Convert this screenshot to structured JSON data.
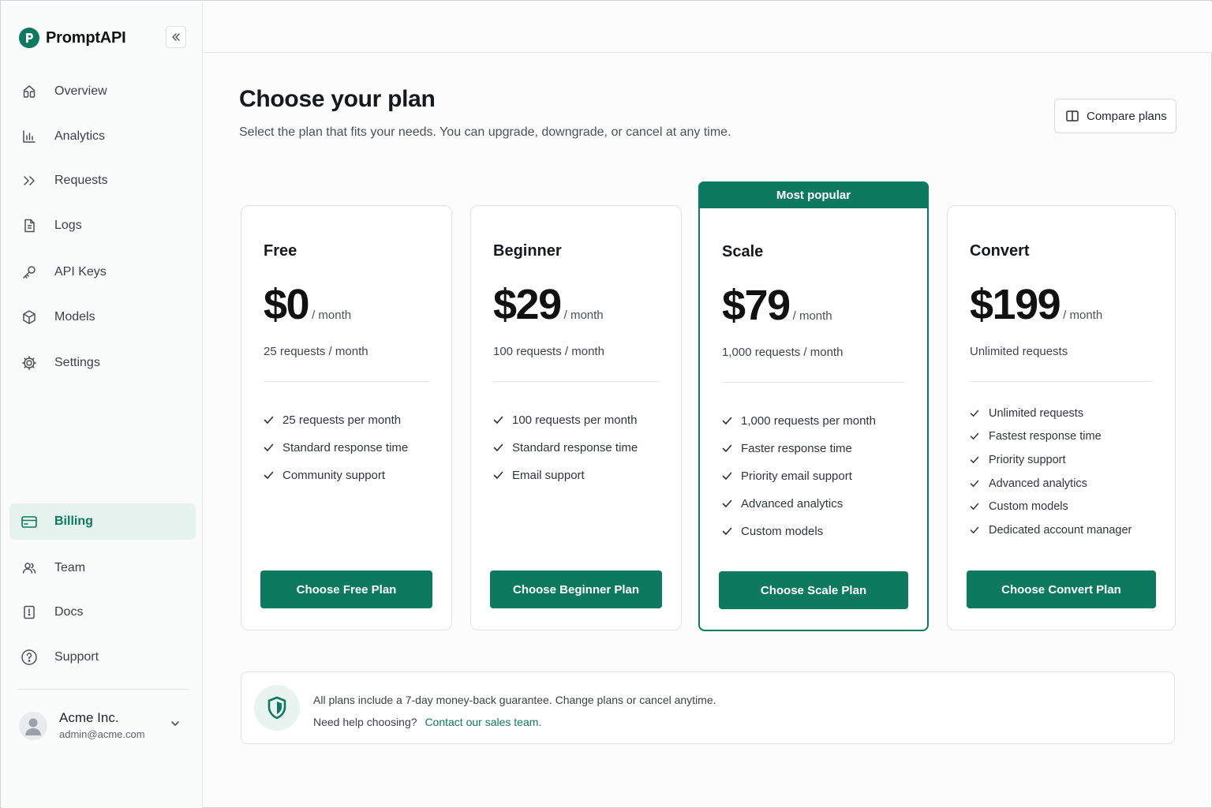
{
  "brand": {
    "name": "PromptAPI"
  },
  "sidebar": {
    "items": [
      {
        "label": "Overview",
        "icon": "home-icon"
      },
      {
        "label": "Analytics",
        "icon": "bar-chart-icon"
      },
      {
        "label": "Requests",
        "icon": "chevrons-right-icon"
      },
      {
        "label": "Logs",
        "icon": "document-icon"
      },
      {
        "label": "API Keys",
        "icon": "key-icon"
      },
      {
        "label": "Models",
        "icon": "cube-icon"
      },
      {
        "label": "Settings",
        "icon": "gear-icon"
      },
      {
        "label": "Billing",
        "icon": "credit-card-icon",
        "active": true
      },
      {
        "label": "Team",
        "icon": "users-icon"
      },
      {
        "label": "Docs",
        "icon": "book-icon"
      },
      {
        "label": "Support",
        "icon": "help-circle-icon"
      }
    ],
    "account": {
      "name": "Acme Inc.",
      "email": "admin@acme.com"
    }
  },
  "header": {
    "title": "Choose your plan",
    "subtitle": "Select the plan that fits your needs. You can upgrade, downgrade, or cancel at any time.",
    "compare_label": "Compare plans"
  },
  "plans": [
    {
      "name": "Free",
      "price": "$0",
      "period": "/ month",
      "quota": "25 requests / month",
      "features": [
        "25 requests per month",
        "Standard response time",
        "Community support"
      ],
      "cta": "Choose Free Plan"
    },
    {
      "name": "Beginner",
      "price": "$29",
      "period": "/ month",
      "quota": "100 requests / month",
      "features": [
        "100 requests per month",
        "Standard response time",
        "Email support"
      ],
      "cta": "Choose Beginner Plan"
    },
    {
      "name": "Scale",
      "price": "$79",
      "period": "/ month",
      "quota": "1,000 requests / month",
      "badge": "Most popular",
      "features": [
        "1,000 requests per month",
        "Faster response time",
        "Priority email support",
        "Advanced analytics",
        "Custom models"
      ],
      "cta": "Choose Scale Plan"
    },
    {
      "name": "Convert",
      "price": "$199",
      "period": "/ month",
      "quota": "Unlimited requests",
      "features": [
        "Unlimited requests",
        "Fastest response time",
        "Priority support",
        "Advanced analytics",
        "Custom models",
        "Dedicated account manager"
      ],
      "cta": "Choose Convert Plan"
    }
  ],
  "guarantee": {
    "line1": "All plans include a 7-day money-back guarantee. Change plans or cancel anytime.",
    "line2_prefix": "Need help choosing?",
    "link": "Contact our sales team."
  },
  "colors": {
    "accent": "#0d7a5f",
    "accent_light": "#e6f2ed"
  }
}
